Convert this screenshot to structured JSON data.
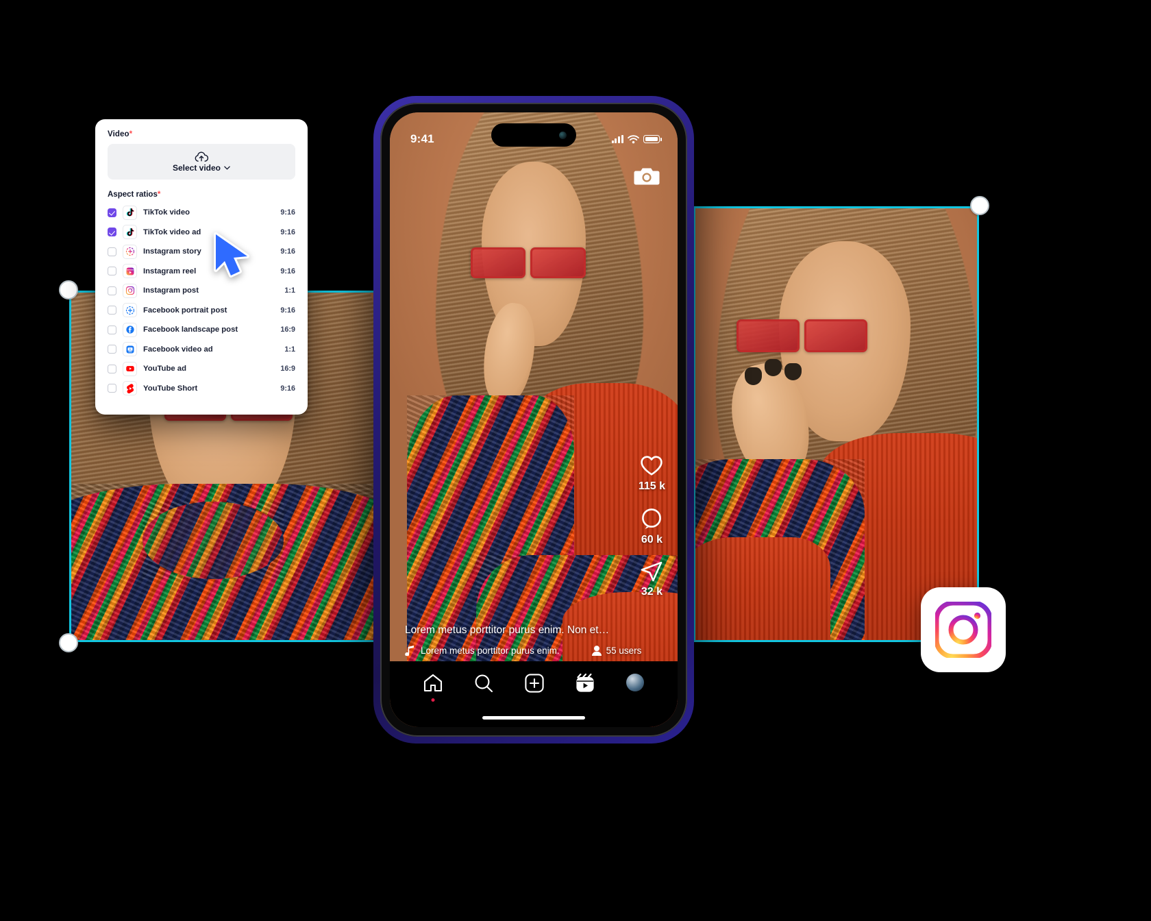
{
  "panel": {
    "video_label": "Video",
    "required_mark": "*",
    "select_video_label": "Select video",
    "upload_icon": "cloud-upload-icon",
    "chevron_icon": "chevron-down-icon",
    "aspect_ratios_label": "Aspect ratios",
    "ratios": [
      {
        "name": "TikTok video",
        "value": "9:16",
        "checked": true,
        "icon": "tiktok-icon"
      },
      {
        "name": "TikTok video ad",
        "value": "9:16",
        "checked": true,
        "icon": "tiktok-icon"
      },
      {
        "name": "Instagram story",
        "value": "9:16",
        "checked": false,
        "icon": "instagram-story-icon"
      },
      {
        "name": "Instagram reel",
        "value": "9:16",
        "checked": false,
        "icon": "instagram-reel-icon"
      },
      {
        "name": "Instagram post",
        "value": "1:1",
        "checked": false,
        "icon": "instagram-icon"
      },
      {
        "name": "Facebook portrait post",
        "value": "9:16",
        "checked": false,
        "icon": "facebook-story-icon"
      },
      {
        "name": "Facebook landscape post",
        "value": "16:9",
        "checked": false,
        "icon": "facebook-icon"
      },
      {
        "name": "Facebook video ad",
        "value": "1:1",
        "checked": false,
        "icon": "facebook-video-icon"
      },
      {
        "name": "YouTube ad",
        "value": "16:9",
        "checked": false,
        "icon": "youtube-icon"
      },
      {
        "name": "YouTube Short",
        "value": "9:16",
        "checked": false,
        "icon": "youtube-shorts-icon"
      }
    ]
  },
  "cursor": {
    "icon": "mouse-pointer-icon"
  },
  "phone": {
    "status": {
      "time": "9:41",
      "signal_icon": "cellular-bars-icon",
      "wifi_icon": "wifi-icon",
      "battery_icon": "battery-icon"
    },
    "camera_icon": "camera-icon",
    "rail": [
      {
        "icon": "heart-icon",
        "count": "115 k"
      },
      {
        "icon": "comment-icon",
        "count": "60 k"
      },
      {
        "icon": "share-icon",
        "count": "32 k"
      }
    ],
    "caption": {
      "text": "Lorem metus porttitor purus enim. Non et…",
      "music_icon": "music-note-icon",
      "music_text": "Lorem metus porttitor purus enim.",
      "users_icon": "person-icon",
      "users_text": "55 users"
    },
    "tabs": [
      {
        "name": "home",
        "icon": "home-icon"
      },
      {
        "name": "search",
        "icon": "search-icon"
      },
      {
        "name": "create",
        "icon": "plus-square-icon"
      },
      {
        "name": "reels",
        "icon": "reels-icon"
      },
      {
        "name": "profile",
        "icon": "avatar-icon"
      }
    ]
  },
  "badge": {
    "icon": "instagram-logo-icon"
  },
  "colors": {
    "accent_purple": "#7048e8",
    "selection_cyan": "#12c6e0",
    "cursor_blue": "#2f6bff",
    "phone_frame": "#241a74",
    "required_red": "#ff4d4f",
    "background": "#000000"
  }
}
